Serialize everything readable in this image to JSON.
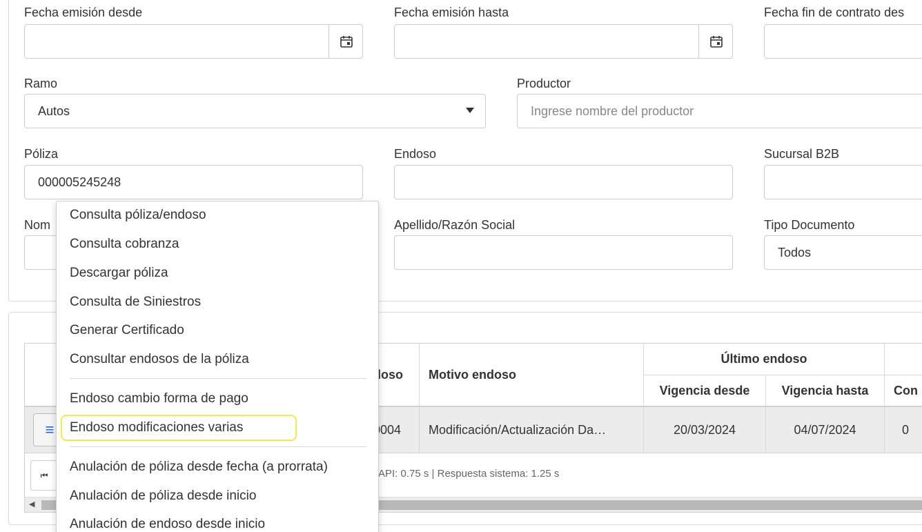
{
  "filters": {
    "fecha_desde": {
      "label": "Fecha emisión desde",
      "value": ""
    },
    "fecha_hasta": {
      "label": "Fecha emisión hasta",
      "value": ""
    },
    "fecha_fin": {
      "label": "Fecha fin de contrato des",
      "value": ""
    },
    "ramo": {
      "label": "Ramo",
      "value": "Autos"
    },
    "productor": {
      "label": "Productor",
      "placeholder": "Ingrese nombre del productor"
    },
    "poliza": {
      "label": "Póliza",
      "value": "000005245248"
    },
    "endoso": {
      "label": "Endoso",
      "value": ""
    },
    "sucursal": {
      "label": "Sucursal B2B",
      "value": ""
    },
    "nombre": {
      "label": "Nom"
    },
    "apellido": {
      "label": "Apellido/Razón Social",
      "value": ""
    },
    "tipo_doc": {
      "label": "Tipo Documento",
      "value": "Todos"
    }
  },
  "table": {
    "headers": {
      "endoso": "doso",
      "motivo": "Motivo endoso",
      "ultimo": "Último endoso",
      "vig_desde": "Vigencia desde",
      "vig_hasta": "Vigencia hasta",
      "com": "Con"
    },
    "row": {
      "action_icon": "≡",
      "endoso": "0004",
      "motivo": "Modificación/Actualización Da…",
      "vig_desde": "20/03/2024",
      "vig_hasta": "04/07/2024",
      "com": "0"
    },
    "timing": "API: 0.75 s | Respuesta sistema: 1.25 s",
    "pager_first": "⏮"
  },
  "menu": {
    "items": [
      "Consulta póliza/endoso",
      "Consulta cobranza",
      "Descargar póliza",
      "Consulta de Siniestros",
      "Generar Certificado",
      "Consultar endosos de la póliza",
      "Endoso cambio forma de pago",
      "Endoso modificaciones varias",
      "Anulación de póliza desde fecha (a prorrata)",
      "Anulación de póliza desde inicio",
      "Anulación de endoso desde inicio"
    ],
    "highlight_color": "#f2e94e"
  }
}
